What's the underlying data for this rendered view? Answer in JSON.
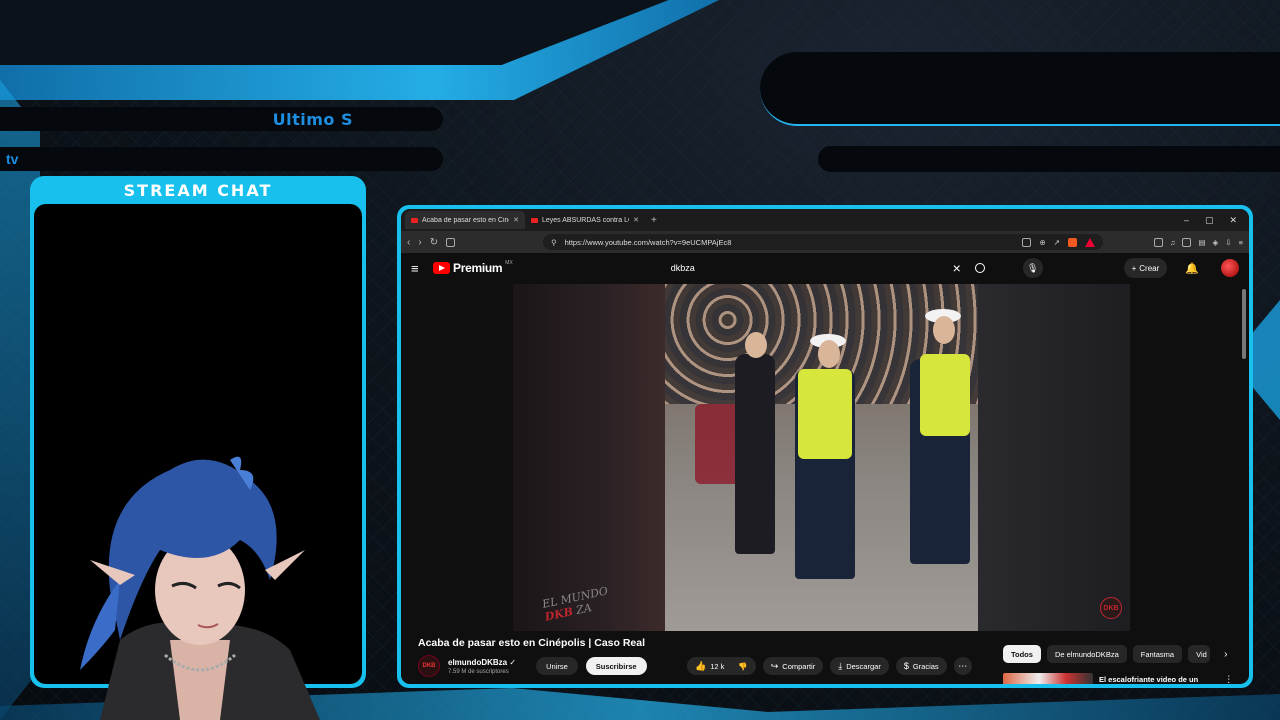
{
  "overlay": {
    "last_sub_label": "Ultimo S",
    "tv_label": "tv",
    "chat_title": "STREAM CHAT"
  },
  "browser": {
    "tabs": [
      {
        "title": "Acaba de pasar esto en Ciné",
        "active": true
      },
      {
        "title": "Leyes ABSURDAS contra LOS VIDEO",
        "active": false
      }
    ],
    "new_tab": "+",
    "window_controls": [
      "–",
      "▢",
      "✕"
    ],
    "url": "https://www.youtube.com/watch?v=9eUCMPAjEc8"
  },
  "youtube": {
    "brand": "Premium",
    "country": "MX",
    "search_query": "dkbza",
    "create_label": "Crear",
    "video_title": "Acaba de pasar esto en Cinépolis | Caso Real",
    "channel_name": "elmundoDKBza",
    "subscribers": "7.59 M de suscriptores",
    "join_label": "Unirse",
    "subscribe_label": "Suscribirse",
    "likes": "12 k",
    "share_label": "Compartir",
    "download_label": "Descargar",
    "thanks_label": "Gracias",
    "chips": [
      "Todos",
      "De elmundoDKBza",
      "Fantasma",
      "Vid"
    ],
    "recommended_title": "El escalofriante video de un",
    "watermark_left_top": "EL MUNDO",
    "watermark_left_mid": "DKB",
    "watermark_left_bottom": "ZA",
    "watermark_right": "DKB",
    "channel_avatar_text": "DKB"
  },
  "colors": {
    "accent": "#18c0ee",
    "youtube_red": "#ff0000",
    "background": "#0b1117"
  }
}
